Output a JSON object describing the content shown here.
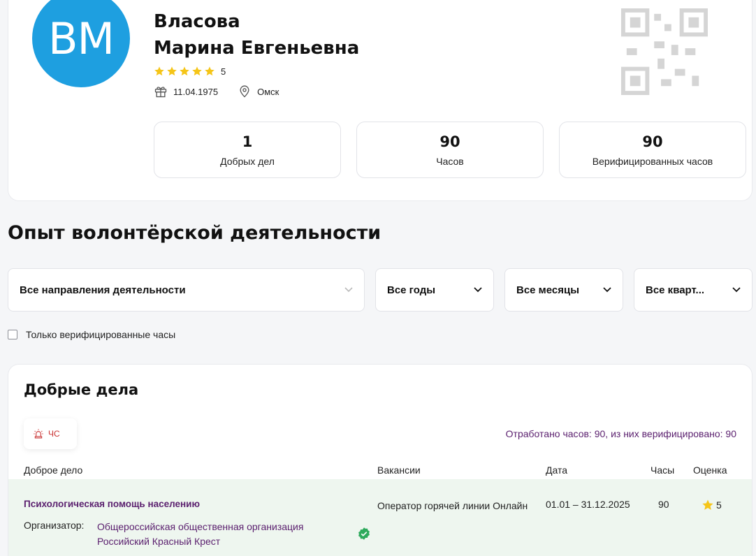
{
  "profile": {
    "initials": "ВМ",
    "last_name": "Власова",
    "first_names": "Марина Евгеньевна",
    "rating": "5",
    "birthdate": "11.04.1975",
    "city": "Омск",
    "avatar_color": "#1e9fe0",
    "stats": [
      {
        "value": "1",
        "label": "Добрых дел"
      },
      {
        "value": "90",
        "label": "Часов"
      },
      {
        "value": "90",
        "label": "Верифицированных часов"
      }
    ]
  },
  "section": {
    "title": "Опыт волонтёрской деятельности"
  },
  "filters": {
    "direction": "Все направления деятельности",
    "years": "Все годы",
    "months": "Все месяцы",
    "quarters": "Все кварт..."
  },
  "verified_only_label": "Только верифицированные часы",
  "deeds": {
    "title": "Добрые дела",
    "tag": "ЧС",
    "summary": "Отработано часов: 90, из них верифицировано: 90",
    "columns": {
      "deed": "Доброе дело",
      "vacancies": "Вакансии",
      "date": "Дата",
      "hours": "Часы",
      "score": "Оценка"
    },
    "rows": [
      {
        "title": "Психологическая помощь населению",
        "organizer_label": "Организатор:",
        "organizer": "Общероссийская общественная организация Российский Красный Крест",
        "vacancy": "Оператор горячей линии Онлайн",
        "date": "01.01 – 31.12.2025",
        "hours": "90",
        "score": "5"
      }
    ]
  },
  "colors": {
    "accent_purple": "#5a1f6e",
    "star": "#f5c518",
    "verified_green": "#2eaa5c",
    "row_bg": "#eef6ef",
    "tag_red": "#c93232"
  }
}
